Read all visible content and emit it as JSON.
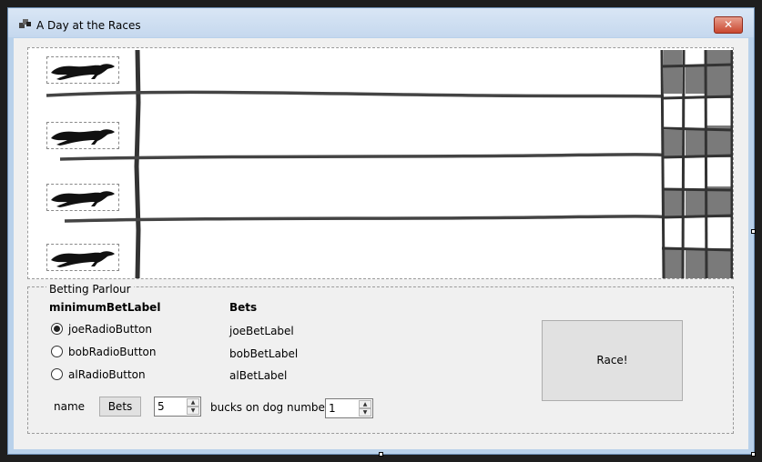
{
  "window": {
    "title": "A Day at the Races",
    "close_glyph": "✕"
  },
  "track": {
    "dogs": [
      "greyhound-1",
      "greyhound-2",
      "greyhound-3",
      "greyhound-4"
    ]
  },
  "parlour": {
    "title": "Betting Parlour",
    "minimum_bet_label": "minimumBetLabel",
    "bets_header": "Bets",
    "radios": [
      {
        "label": "joeRadioButton",
        "checked": true
      },
      {
        "label": "bobRadioButton",
        "checked": false
      },
      {
        "label": "alRadioButton",
        "checked": false
      }
    ],
    "bet_labels": [
      "joeBetLabel",
      "bobBetLabel",
      "alBetLabel"
    ],
    "name_label": "name",
    "bets_button": "Bets",
    "amount_value": "5",
    "bucks_label": "bucks on dog number",
    "dog_number_value": "1",
    "race_button": "Race!"
  }
}
